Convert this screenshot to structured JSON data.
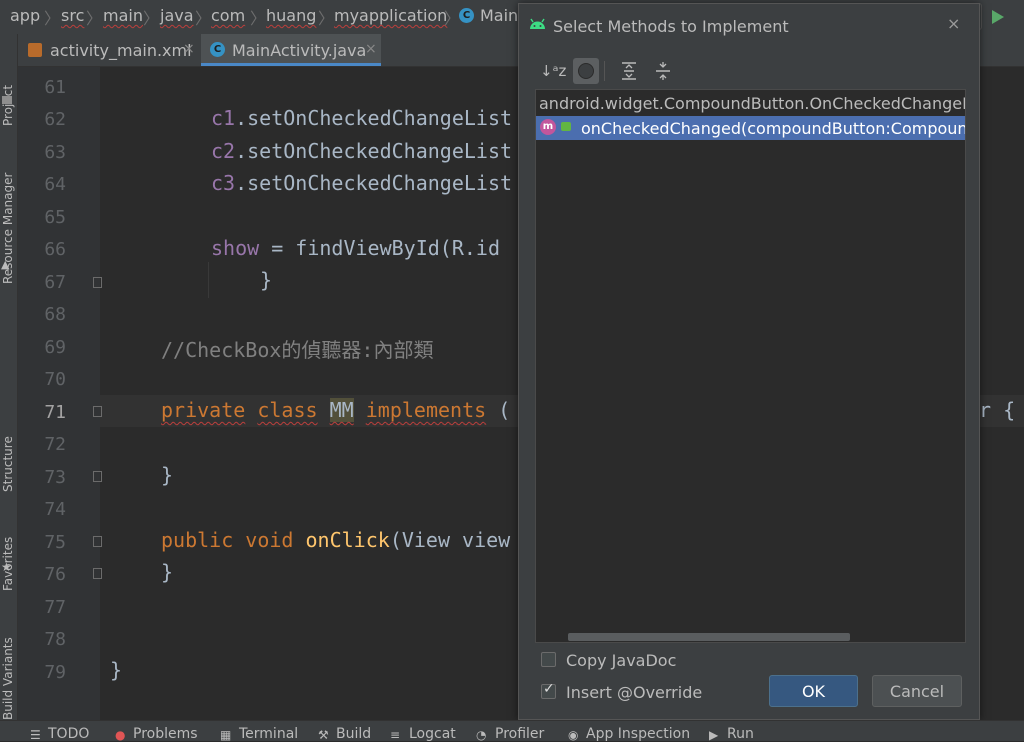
{
  "breadcrumb": {
    "items": [
      "app",
      "src",
      "main",
      "java",
      "com",
      "huang",
      "myapplication",
      "Main"
    ],
    "separator": "〉"
  },
  "tabs": [
    {
      "label": "activity_main.xml",
      "close": "×"
    },
    {
      "label": "MainActivity.java",
      "close": "×"
    }
  ],
  "left_strip": [
    "Project",
    "Resource Manager",
    "Structure",
    "Favorites",
    "Build Variants"
  ],
  "editor": {
    "line_numbers": [
      "61",
      "62",
      "63",
      "64",
      "65",
      "66",
      "67",
      "68",
      "69",
      "70",
      "71",
      "72",
      "73",
      "74",
      "75",
      "76",
      "77",
      "78",
      "79"
    ],
    "current_line": "71",
    "lines": {
      "l62": {
        "obj": "c1",
        "rest": ".setOnCheckedChangeList"
      },
      "l63": {
        "obj": "c2",
        "rest": ".setOnCheckedChangeList"
      },
      "l64": {
        "obj": "c3",
        "rest": ".setOnCheckedChangeList"
      },
      "l66": {
        "field": "show",
        "rest": " = findViewById(R.id"
      },
      "l67": "}",
      "l69": "//CheckBox的偵聽器:內部類",
      "l71": {
        "kw1": "private",
        "kw2": "class",
        "name": "MM",
        "kw3": "implements",
        "rest": " (",
        "tail": "r {"
      },
      "l73": "}",
      "l75": {
        "kw1": "public",
        "kw2": "void",
        "method": "onClick",
        "rest": "(View view"
      },
      "l76": "}",
      "l79": "}"
    }
  },
  "dialog": {
    "title": "Select Methods to Implement",
    "close": "×",
    "toolbar": {
      "sort": "↓ᵃz",
      "expand": "≡",
      "collapse": "≡"
    },
    "list": {
      "group": "android.widget.CompoundButton.OnCheckedChangeListener",
      "method": "onCheckedChanged(compoundButton:CompoundButton, b:boolean):void",
      "method_icon_letter": "m"
    },
    "copy_javadoc": {
      "label": "Copy JavaDoc",
      "checked": false
    },
    "insert_override": {
      "label": "Insert @Override",
      "checked": true
    },
    "ok_label": "OK",
    "cancel_label": "Cancel"
  },
  "bottom_bar": [
    "TODO",
    "Problems",
    "Terminal",
    "Build",
    "Logcat",
    "Profiler",
    "App Inspection",
    "Run"
  ],
  "colors": {
    "accent": "#4b6eaf",
    "ok_button": "#365880",
    "run": "#59a869",
    "android": "#3ddc84"
  }
}
